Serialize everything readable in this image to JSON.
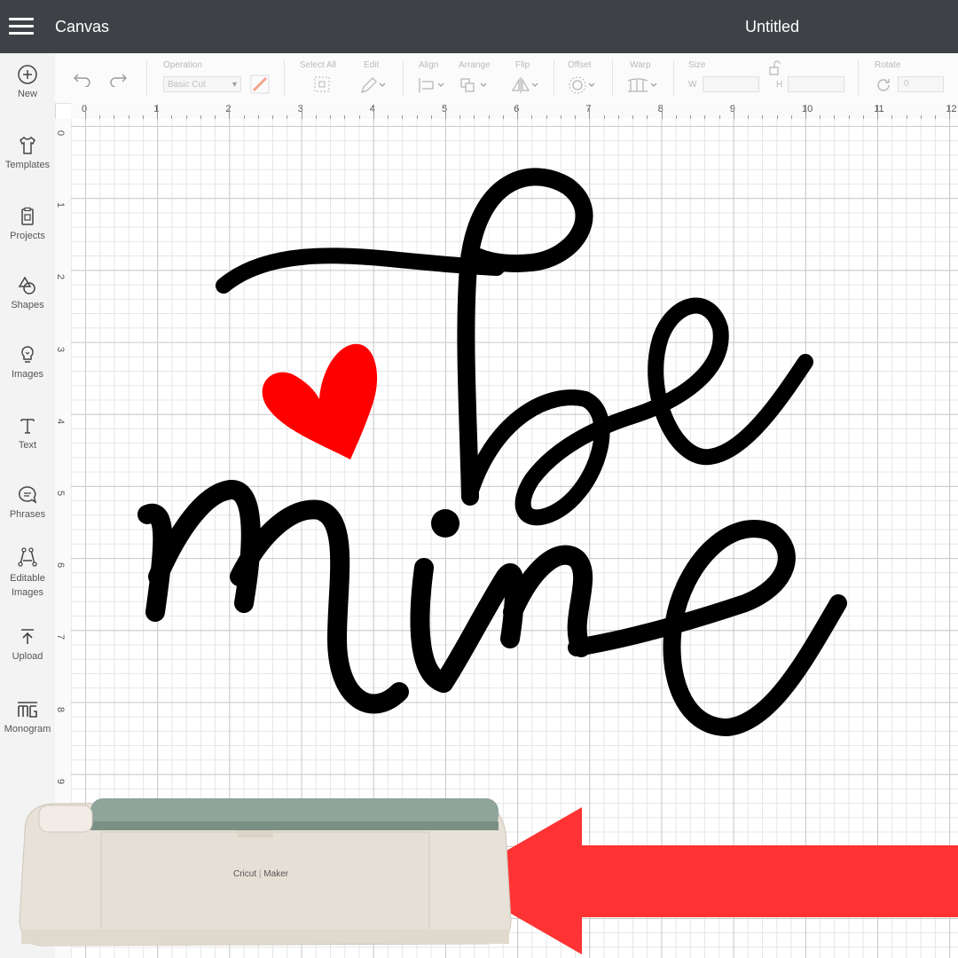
{
  "topbar": {
    "app_title": "Canvas",
    "document_title": "Untitled"
  },
  "sidebar": {
    "items": [
      {
        "label": "New",
        "icon": "plus-circle-icon"
      },
      {
        "label": "Templates",
        "icon": "tshirt-icon"
      },
      {
        "label": "Projects",
        "icon": "clipboard-icon"
      },
      {
        "label": "Shapes",
        "icon": "shapes-icon"
      },
      {
        "label": "Images",
        "icon": "lightbulb-icon"
      },
      {
        "label": "Text",
        "icon": "text-t-icon"
      },
      {
        "label": "Phrases",
        "icon": "speech-bubble-icon"
      },
      {
        "label": "Editable Images",
        "icon": "editable-image-icon"
      },
      {
        "label": "Upload",
        "icon": "upload-arrow-icon"
      },
      {
        "label": "Monogram",
        "icon": "monogram-icon"
      }
    ]
  },
  "toolbar": {
    "operation_label": "Operation",
    "operation_value": "Basic Cut",
    "select_all_label": "Select All",
    "edit_label": "Edit",
    "align_label": "Align",
    "arrange_label": "Arrange",
    "flip_label": "Flip",
    "offset_label": "Offset",
    "warp_label": "Warp",
    "size_label": "Size",
    "size_w_label": "W",
    "size_h_label": "H",
    "rotate_label": "Rotate",
    "rotate_value": "0"
  },
  "rulers": {
    "top": [
      "0",
      "1",
      "2",
      "3",
      "4",
      "5",
      "6",
      "7",
      "8",
      "9",
      "10",
      "11",
      "12"
    ],
    "left": [
      "0",
      "1",
      "2",
      "3",
      "4",
      "5",
      "6",
      "7",
      "8",
      "9"
    ]
  },
  "artwork": {
    "heart_color": "#ff0000",
    "lettering_color": "#000000",
    "arrow_color": "#ff3333"
  },
  "machine": {
    "brand": "Cricut",
    "model": "Maker"
  }
}
